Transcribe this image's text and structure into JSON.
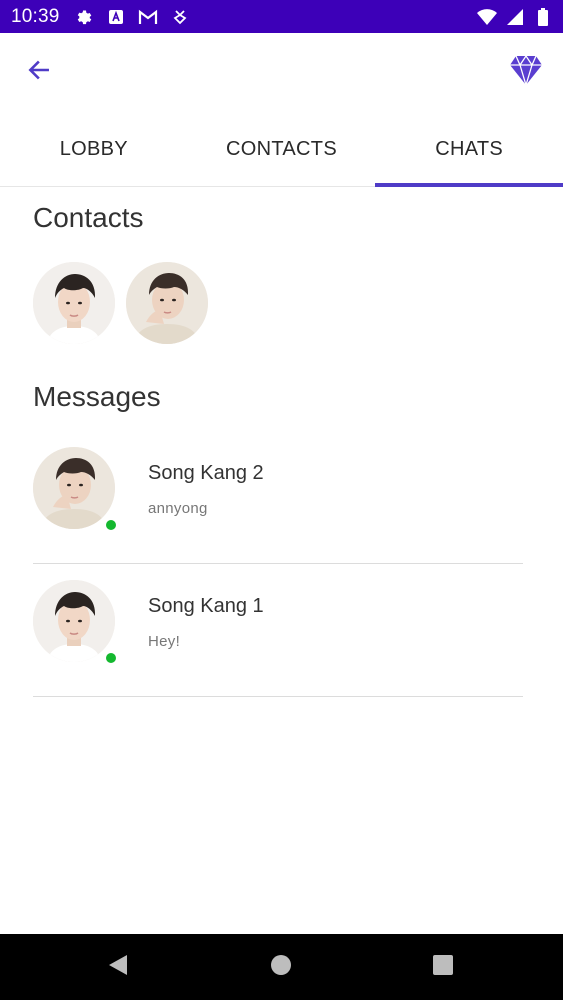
{
  "status_bar": {
    "time": "10:39",
    "left_icons": [
      "gear-icon",
      "a-box-icon",
      "gmail-icon",
      "download-badge-icon"
    ],
    "right_icons": [
      "wifi-icon",
      "signal-icon",
      "battery-icon"
    ],
    "background": "#3d00b8"
  },
  "app_bar": {
    "back_icon": "arrow-left-icon",
    "premium_icon": "diamond-icon",
    "accent": "#4f3bc7"
  },
  "tabs": [
    {
      "label": "LOBBY",
      "active": false
    },
    {
      "label": "CONTACTS",
      "active": false
    },
    {
      "label": "CHATS",
      "active": true
    }
  ],
  "contacts": {
    "title": "Contacts",
    "items": [
      {
        "avatar": "profile-photo-1"
      },
      {
        "avatar": "profile-photo-2"
      }
    ]
  },
  "messages": {
    "title": "Messages",
    "items": [
      {
        "name": "Song Kang 2",
        "preview": "annyong",
        "online": true,
        "avatar": "profile-photo-2"
      },
      {
        "name": "Song Kang 1",
        "preview": "Hey!",
        "online": true,
        "avatar": "profile-photo-1"
      }
    ],
    "online_color": "#14b82f"
  },
  "nav_bar": {
    "buttons": [
      "back-triangle-icon",
      "home-circle-icon",
      "recents-square-icon"
    ]
  }
}
